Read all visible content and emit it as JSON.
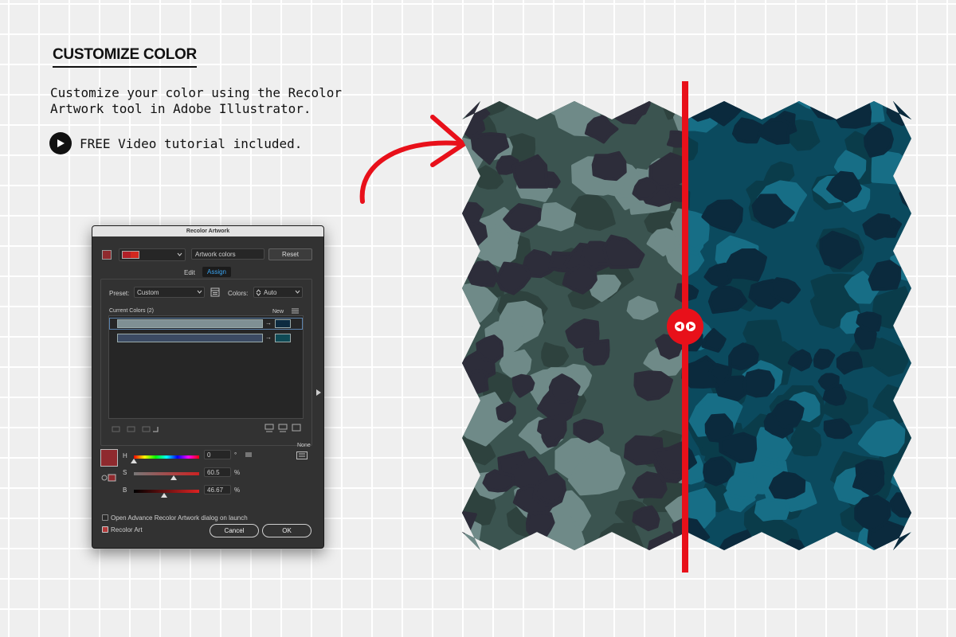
{
  "intro": {
    "heading": "CUSTOMIZE COLOR",
    "description": "Customize your color using the Recolor Artwork tool in Adobe Illustrator.",
    "video_text": "FREE Video tutorial included."
  },
  "dialog": {
    "title": "Recolor Artwork",
    "artwork_colors": "Artwork colors",
    "reset": "Reset",
    "tabs": [
      "Edit",
      "Assign"
    ],
    "active_tab": "Assign",
    "preset_label": "Preset:",
    "preset_value": "Custom",
    "colors_label": "Colors:",
    "colors_value": "Auto",
    "current_colors": "Current Colors (2)",
    "new_label": "New",
    "color_rows": [
      {
        "current": "#7f9094",
        "new": "#0d2b40"
      },
      {
        "current": "#3b4a63",
        "new": "#0f4a55"
      }
    ],
    "none_label": "None",
    "sliders": [
      {
        "label": "H",
        "value": "0",
        "unit": "°",
        "fraction": 0.0
      },
      {
        "label": "S",
        "value": "60.5",
        "unit": "%",
        "fraction": 0.605
      },
      {
        "label": "B",
        "value": "46.67",
        "unit": "%",
        "fraction": 0.4667
      }
    ],
    "selected_color": "#8f2a2e",
    "advance_option": "Open Advance Recolor Artwork dialog on launch",
    "recolor_art": "Recolor Art",
    "cancel": "Cancel",
    "ok": "OK"
  },
  "colors": {
    "accent_red": "#e8101a",
    "left_base": "#3b5450",
    "right_base": "#0b4a5e"
  }
}
